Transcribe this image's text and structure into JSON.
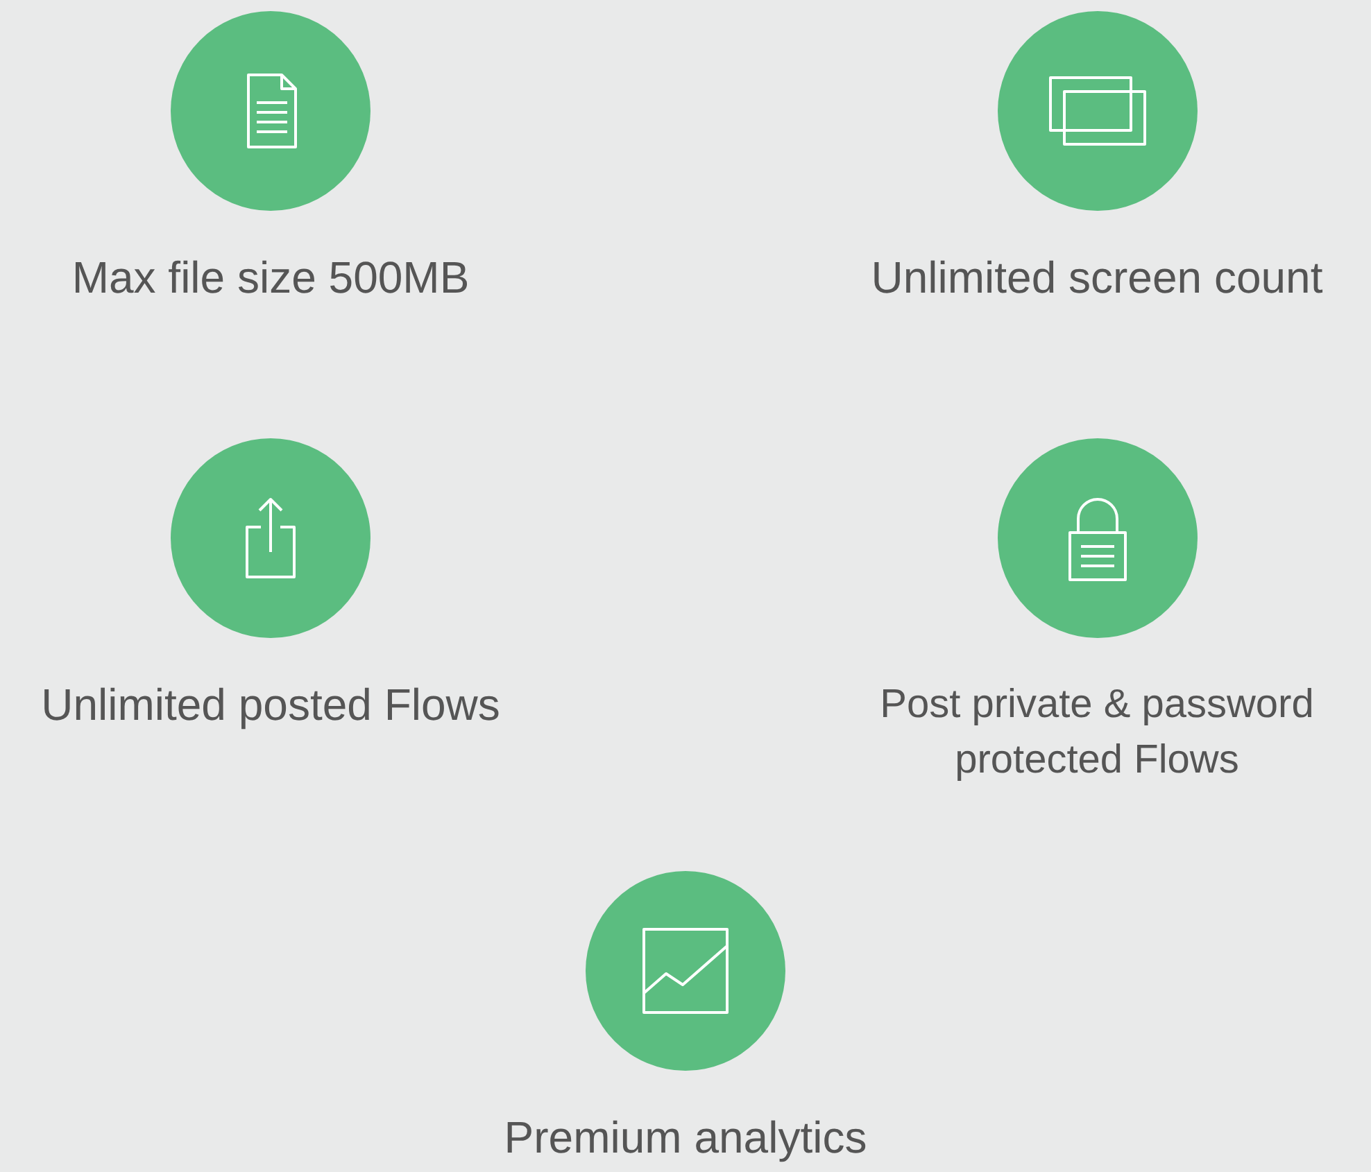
{
  "features": [
    {
      "kind": "document",
      "label": "Max file size 500MB"
    },
    {
      "kind": "screens",
      "label": "Unlimited screen count"
    },
    {
      "kind": "share",
      "label": "Unlimited posted Flows"
    },
    {
      "kind": "lock",
      "label": "Post private & password protected Flows"
    },
    {
      "kind": "chart",
      "label": "Premium analytics"
    }
  ]
}
